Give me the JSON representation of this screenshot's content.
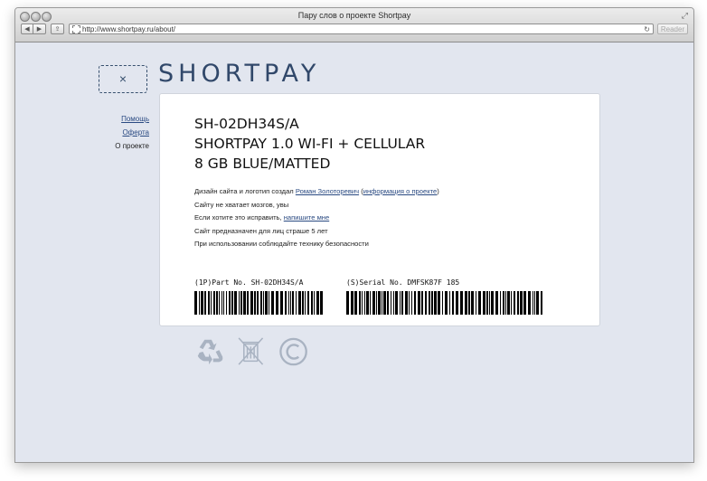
{
  "window": {
    "title": "Пару слов о проекте Shortpay",
    "resize_glyph": "⤢",
    "back_glyph": "◀",
    "forward_glyph": "▶",
    "share_glyph": "⇪",
    "url": "http://www.shortpay.ru/about/",
    "reload_glyph": "↻",
    "reader_label": "Reader"
  },
  "logo": {
    "mark": "×",
    "brand": "SHORTPAY"
  },
  "nav": {
    "items": [
      {
        "label": "Помощь"
      },
      {
        "label": "Оферта"
      },
      {
        "label": "О проекте"
      }
    ]
  },
  "card": {
    "model_lines": [
      "SH-02DH34S/A",
      "SHORTPAY 1.0 WI-FI + CELLULAR",
      "8 GB BLUE/MATTED"
    ],
    "credits_prefix": "Дизайн сайта и логотип создал ",
    "credits_author": "Роман Золоторевич",
    "credits_open": " (",
    "credits_link": "информация о проекте",
    "credits_close": ")",
    "line2": "Сайту не хватает мозгов, увы",
    "fix_prefix": "Если хотите это исправить, ",
    "fix_link": "напишите мне",
    "line4": "Сайт предназначен для лиц страше 5 лет",
    "line5": "При использовании соблюдайте технику безопасности",
    "part_label": "(1P)Part No. SH-02DH34S/A",
    "serial_label": "(S)Serial No. DMFSK87F 185"
  },
  "icons": {
    "recycle": "recycle-icon",
    "no_trash": "crossed-bin-icon",
    "copyright": "copyright-icon"
  },
  "colors": {
    "background": "#e2e6ef",
    "brand": "#31486a",
    "link": "#2a4a82",
    "icon_gray": "#a9b3c2"
  }
}
